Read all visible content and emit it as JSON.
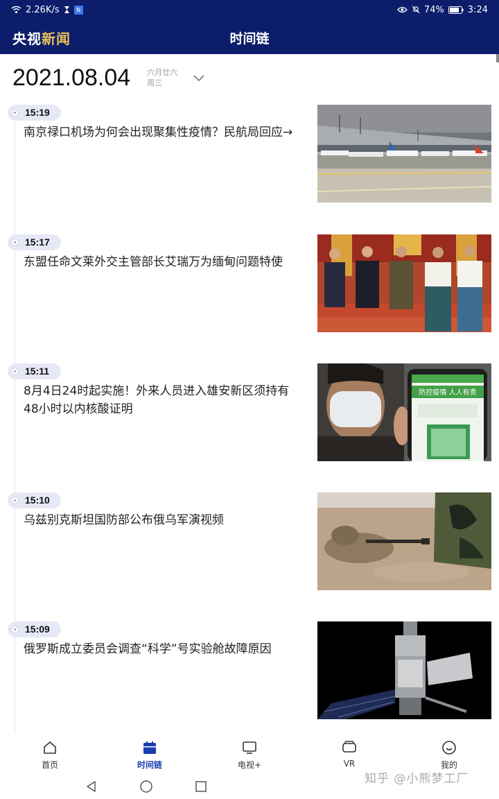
{
  "status_bar": {
    "speed": "2.26K/s",
    "battery": "74%",
    "time": "3:24",
    "nfc_badge": "N"
  },
  "header": {
    "brand_part1": "央视",
    "brand_part2": "新闻",
    "title": "时间链"
  },
  "date": {
    "main": "2021.08.04",
    "lunar": "六月廿六",
    "weekday": "周三"
  },
  "news": [
    {
      "time": "15:19",
      "title": "南京禄口机场为何会出现聚集性疫情？民航局回应→",
      "thumb": "airport-photo"
    },
    {
      "time": "15:17",
      "title": "东盟任命文莱外交主管部长艾瑞万为缅甸问题特使",
      "thumb": "officials-group-photo"
    },
    {
      "time": "15:11",
      "title": "8月4日24时起实施！外来人员进入雄安新区须持有48小时以内核酸证明",
      "thumb": "masked-man-health-code-photo"
    },
    {
      "time": "15:10",
      "title": "乌兹别克斯坦国防部公布俄乌军演视频",
      "thumb": "military-exercise-photo"
    },
    {
      "time": "15:09",
      "title": "俄罗斯成立委员会调查“科学”号实验舱故障原因",
      "thumb": "space-module-photo"
    }
  ],
  "health_code_text": "防控疫情 人人有责",
  "bottom_nav": [
    {
      "label": "首页",
      "icon": "home-icon",
      "active": false
    },
    {
      "label": "时间链",
      "icon": "calendar-icon",
      "active": true
    },
    {
      "label": "电视+",
      "icon": "tv-icon",
      "active": false
    },
    {
      "label": "VR",
      "icon": "vr-icon",
      "active": false
    },
    {
      "label": "我的",
      "icon": "smile-icon",
      "active": false
    }
  ],
  "watermark": "知乎 @小熊梦工厂",
  "colors": {
    "header_bg": "#0b1d6b",
    "brand_accent": "#e9c15a",
    "active_tab": "#1a3cb0",
    "time_pill": "#e6e8f5"
  }
}
